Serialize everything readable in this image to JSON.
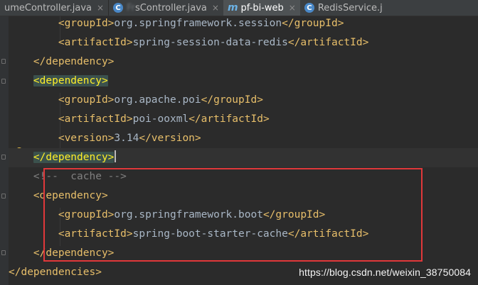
{
  "tabs": [
    {
      "label": "umeController.java",
      "active": false,
      "icon": "none",
      "closable": true
    },
    {
      "label_blur": "Fr",
      "label": "sController.java",
      "active": false,
      "icon": "java-class-icon",
      "closable": true
    },
    {
      "label": "pf-bi-web",
      "active": true,
      "icon": "maven-icon",
      "closable": true
    },
    {
      "label": "RedisService.j",
      "active": false,
      "icon": "java-class-icon",
      "closable": false
    }
  ],
  "code_lines": [
    {
      "indent": "        ",
      "open": "<groupId>",
      "text": "org.springframework.session",
      "close": "</groupId>"
    },
    {
      "indent": "        ",
      "open": "<artifactId>",
      "text": "spring-session-data-redis",
      "close": "</artifactId>"
    },
    {
      "indent": "    ",
      "open": "</dependency>",
      "text": "",
      "close": ""
    },
    {
      "indent": "    ",
      "open": "<dependency>",
      "text": "",
      "close": ""
    },
    {
      "indent": "        ",
      "open": "<groupId>",
      "text": "org.apache.poi",
      "close": "</groupId>"
    },
    {
      "indent": "        ",
      "open": "<artifactId>",
      "text": "poi-ooxml",
      "close": "</artifactId>"
    },
    {
      "indent": "        ",
      "open": "<version>",
      "text": "3.14",
      "close": "</version>"
    },
    {
      "indent": "    ",
      "open": "</dependency>",
      "text": "",
      "close": ""
    },
    {
      "indent": "    ",
      "comment": "<!--  cache -->"
    },
    {
      "indent": "    ",
      "open": "<dependency>",
      "text": "",
      "close": ""
    },
    {
      "indent": "        ",
      "open": "<groupId>",
      "text": "org.springframework.boot",
      "close": "</groupId>"
    },
    {
      "indent": "        ",
      "open": "<artifactId>",
      "text": "spring-boot-starter-cache",
      "close": "</artifactId>"
    },
    {
      "indent": "    ",
      "open": "</dependency>",
      "text": "",
      "close": ""
    },
    {
      "indent": "",
      "open": "</dependencies>",
      "text": "",
      "close": ""
    }
  ],
  "watermark": "https://blog.csdn.net/weixin_38750084",
  "icons": {
    "close": "×",
    "class": "C",
    "maven": "m"
  },
  "colors": {
    "background": "#2b2b2b",
    "tag": "#e8bf6a",
    "text": "#a9b7c6",
    "comment": "#808080",
    "match_bg": "#3b514d",
    "match_fg": "#ffef28",
    "annotation_box": "#e0383a"
  }
}
